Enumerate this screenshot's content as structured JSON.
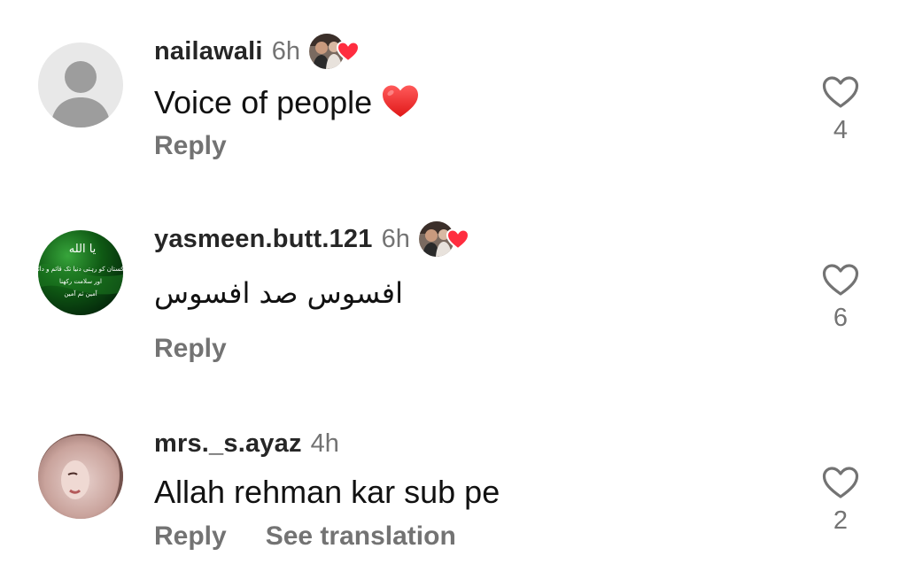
{
  "comments": [
    {
      "username": "nailawali",
      "time": "6h",
      "text": "Voice of people",
      "emoji": "red-heart-emoji",
      "reply_label": "Reply",
      "like_count": "4",
      "liked_by_author": true
    },
    {
      "username": "yasmeen.butt.121",
      "time": "6h",
      "text": "افسوس صد افسوس",
      "avatar_text": [
        "يا الله",
        "پاکستان کو رہتی دنیا تک قائم و دائم",
        "اور سلامت رکھنا",
        "آمین ثم آمین"
      ],
      "reply_label": "Reply",
      "like_count": "6",
      "liked_by_author": true
    },
    {
      "username": "mrs._s.ayaz",
      "time": "4h",
      "text": "Allah rehman kar sub pe",
      "reply_label": "Reply",
      "translate_label": "See translation",
      "like_count": "2",
      "liked_by_author": false
    }
  ],
  "colors": {
    "username": "#262626",
    "secondary": "#737373",
    "heart_red": "#ff2d3f",
    "default_avatar_bg": "#dbdbdb",
    "default_avatar_fg": "#9a9a9a"
  },
  "icons": {
    "like": "heart-outline-icon",
    "author_liked": "author-heart-badge-icon"
  }
}
